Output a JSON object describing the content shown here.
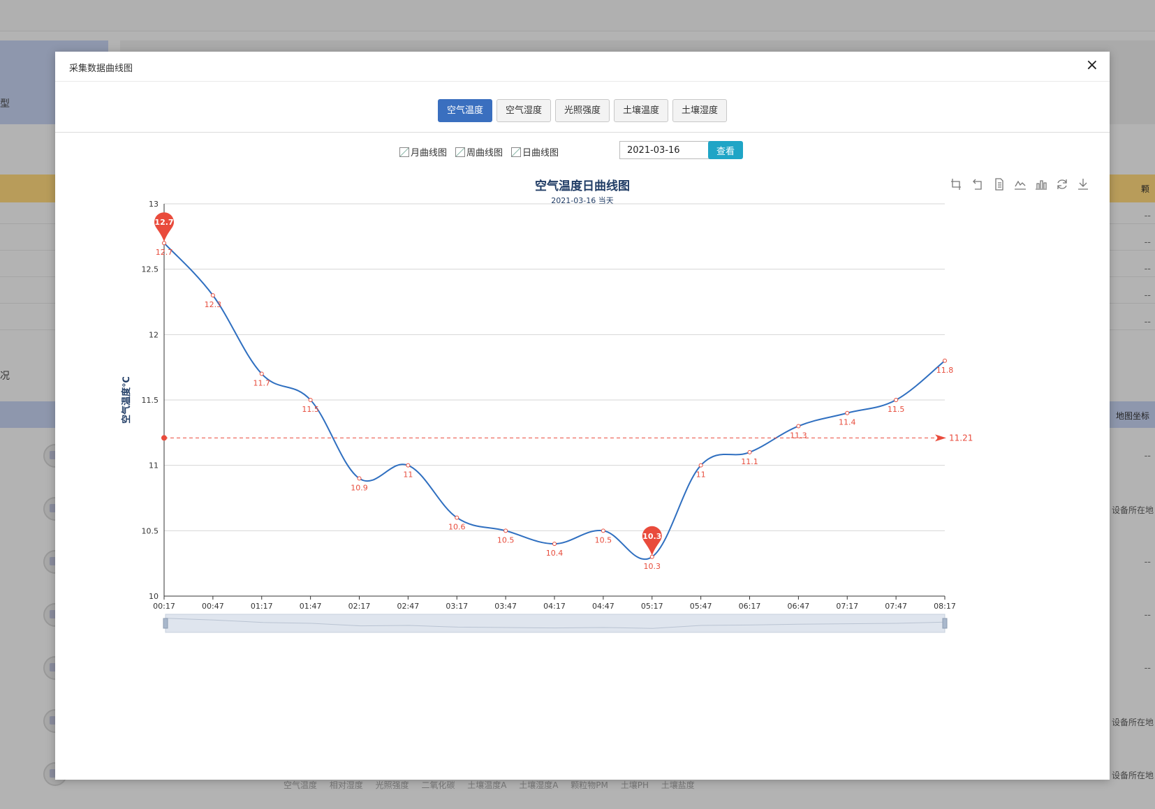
{
  "background": {
    "left_label": "型",
    "strip_right": "颗",
    "caption": "况",
    "blue_strip_right": "地图坐标",
    "row_dash": "--",
    "device_text": "设备所在地",
    "footer": "空气温度 相对湿度 光照强度 二氧化碳 土壤温度A 土壤湿度A 颗粒物PM 土壤PH 土壤盐度"
  },
  "modal": {
    "title": "采集数据曲线图",
    "close": "×"
  },
  "tabs": [
    {
      "label": "空气温度",
      "active": true
    },
    {
      "label": "空气湿度",
      "active": false
    },
    {
      "label": "光照强度",
      "active": false
    },
    {
      "label": "土壤温度",
      "active": false
    },
    {
      "label": "土壤湿度",
      "active": false
    }
  ],
  "controls": {
    "month_link": "月曲线图",
    "week_link": "周曲线图",
    "day_link": "日曲线图",
    "date_value": "2021-03-16",
    "view_button": "查看"
  },
  "toolbox": [
    "zoom-icon",
    "zoom-reset-icon",
    "data-view-icon",
    "line-chart-icon",
    "bar-chart-icon",
    "restore-icon",
    "download-icon"
  ],
  "chart_data": {
    "type": "line",
    "title": "空气温度日曲线图",
    "subtitle": "2021-03-16 当天",
    "ylabel": "空气温度℃",
    "xlabel": "",
    "ylim": [
      10,
      13
    ],
    "yticks": [
      "10",
      "10.5",
      "11",
      "11.5",
      "12",
      "12.5",
      "13"
    ],
    "ytick_values": [
      10,
      10.5,
      11,
      11.5,
      12,
      12.5,
      13
    ],
    "categories": [
      "00:17",
      "00:47",
      "01:17",
      "01:47",
      "02:17",
      "02:47",
      "03:17",
      "03:47",
      "04:17",
      "04:47",
      "05:17",
      "05:47",
      "06:17",
      "06:47",
      "07:17",
      "07:47",
      "08:17"
    ],
    "values": [
      12.7,
      12.3,
      11.7,
      11.5,
      10.9,
      11,
      10.6,
      10.5,
      10.4,
      10.5,
      10.3,
      11,
      11.1,
      11.3,
      11.4,
      11.5,
      11.8
    ],
    "labels": [
      "12.7",
      "12.3",
      "11.7",
      "11.5",
      "10.9",
      "11",
      "10.6",
      "10.5",
      "10.4",
      "10.5",
      "10.3",
      "11",
      "11.1",
      "11.3",
      "11.4",
      "11.5",
      "11.8"
    ],
    "mark_max": {
      "index": 0,
      "label": "12.7"
    },
    "mark_min": {
      "index": 10,
      "label": "10.3"
    },
    "mark_line_average": {
      "value": 11.21,
      "label": "11.21"
    },
    "grid": true,
    "line_color": "#2f6fc0",
    "label_color": "#e74c3c",
    "pin_color": "#e94b3c",
    "average_color": "#e94b3c",
    "datazoom": true
  }
}
